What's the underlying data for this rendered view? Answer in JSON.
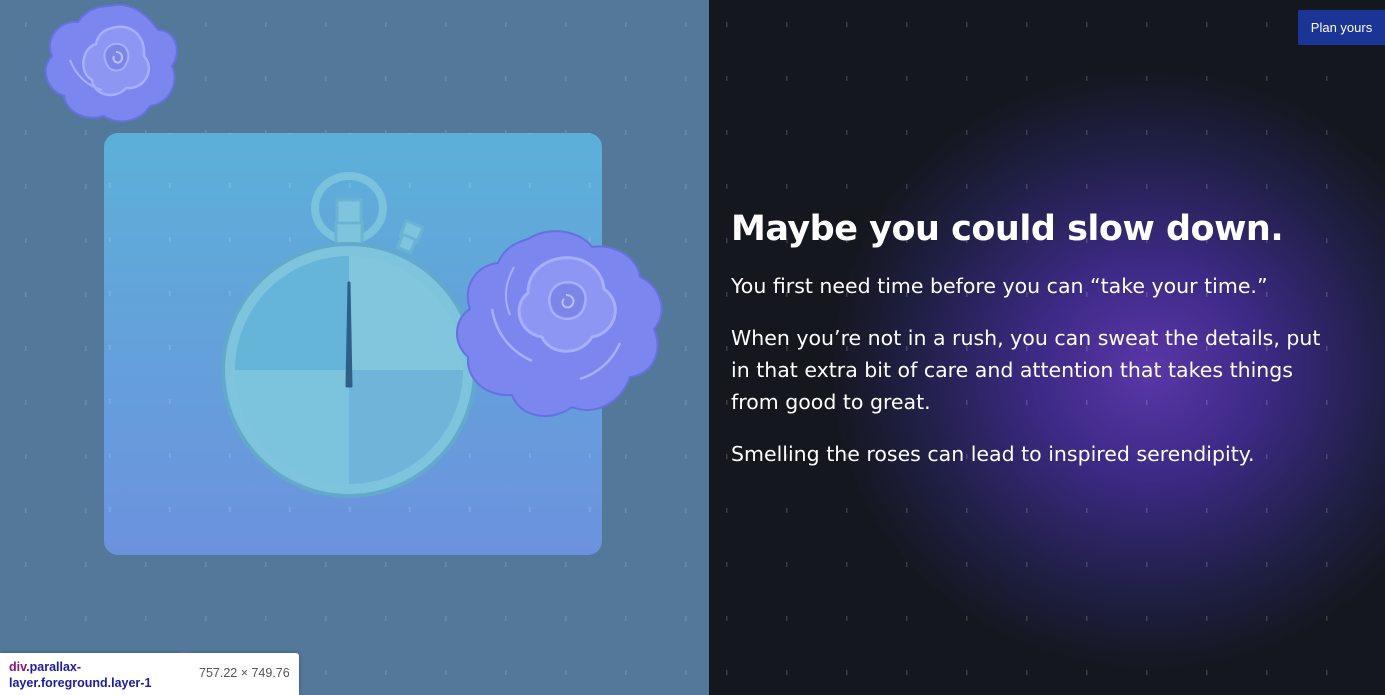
{
  "header": {
    "cta_label": "Plan yours"
  },
  "content": {
    "headline": "Maybe you could slow down.",
    "paragraphs": [
      "You first need time before you can “take your time.”",
      "When you’re not in a rush, you can sweat the details, put in that extra bit of care and attention that takes things from good to great.",
      "Smelling the roses can lead to inspired serendipity."
    ]
  },
  "illustration": {
    "icons": [
      "stopwatch-icon",
      "rose-icon"
    ]
  },
  "devtools_tooltip": {
    "tag": "div",
    "selector": ".parallax-layer.foreground.layer-1",
    "size": "757.22 × 749.76"
  },
  "colors": {
    "left_background": "#53789a",
    "right_background": "#15171f",
    "glow": "#5a37a8",
    "card_top": "#5cb0d8",
    "card_bottom": "#6c92de",
    "cta_background": "#1b3596",
    "rose": "#7b86ee",
    "stopwatch": "#7ec4dd"
  }
}
